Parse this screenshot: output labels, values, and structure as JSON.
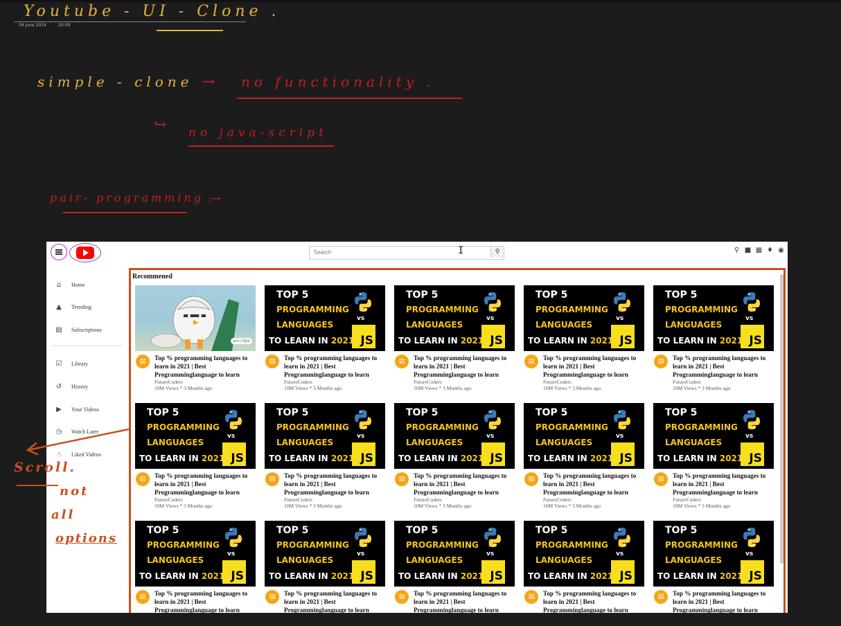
{
  "notes": {
    "title": "Youtube - UI - Clone .",
    "date": "04 June 2024",
    "time": "20:09",
    "line1_left": "simple - clone",
    "line1_arrow": "→",
    "line1_right": "no functionality .",
    "line2_hook": "↪",
    "line2": "no java-script",
    "line3": "pair- programming",
    "line3_arrow": ":→",
    "scroll_note_arrow": "←",
    "scroll_note": "Scroll.",
    "not": "not",
    "all": "all",
    "options": "options"
  },
  "header": {
    "search_placeholder": "Search",
    "search_icon": "search-icon",
    "cursor": "I",
    "icons": [
      "search-icon",
      "video-camera-icon",
      "apps-grid-icon",
      "bell-icon",
      "account-icon"
    ]
  },
  "sidebar": {
    "items": [
      {
        "label": "Home",
        "icon": "home-icon"
      },
      {
        "label": "Trending",
        "icon": "fire-icon"
      },
      {
        "label": "Subscriptions",
        "icon": "subscriptions-icon"
      },
      {
        "label": "Library",
        "icon": "library-icon"
      },
      {
        "label": "History",
        "icon": "history-icon"
      },
      {
        "label": "Your Videos",
        "icon": "play-icon"
      },
      {
        "label": "Watch Later",
        "icon": "clock-icon"
      },
      {
        "label": "Liked Videos",
        "icon": "thumbs-up-icon"
      }
    ]
  },
  "main": {
    "section_title": "Recommened",
    "thumbnail_text": {
      "line1": "TOP 5",
      "line2": "PROGRAMMING",
      "line3": "LANGUAGES",
      "line4": "TO LEARN IN",
      "year": "2021",
      "vs": "vs",
      "js": "JS"
    },
    "anime_watermark": "ani-clips",
    "video": {
      "title": "Top % programming languages to learn in 2021 | Best Programminglanguage to learn",
      "channel": "FutureCoders",
      "meta": "10M Views * 3 Months ago"
    }
  },
  "colors": {
    "accent_red": "#ff0000",
    "annotation_gold": "#e8b33a",
    "annotation_red": "#c81e1e",
    "annotation_orange": "#c8501e",
    "avatar_orange": "#f5a515",
    "thumb_yellow": "#f5c518"
  }
}
